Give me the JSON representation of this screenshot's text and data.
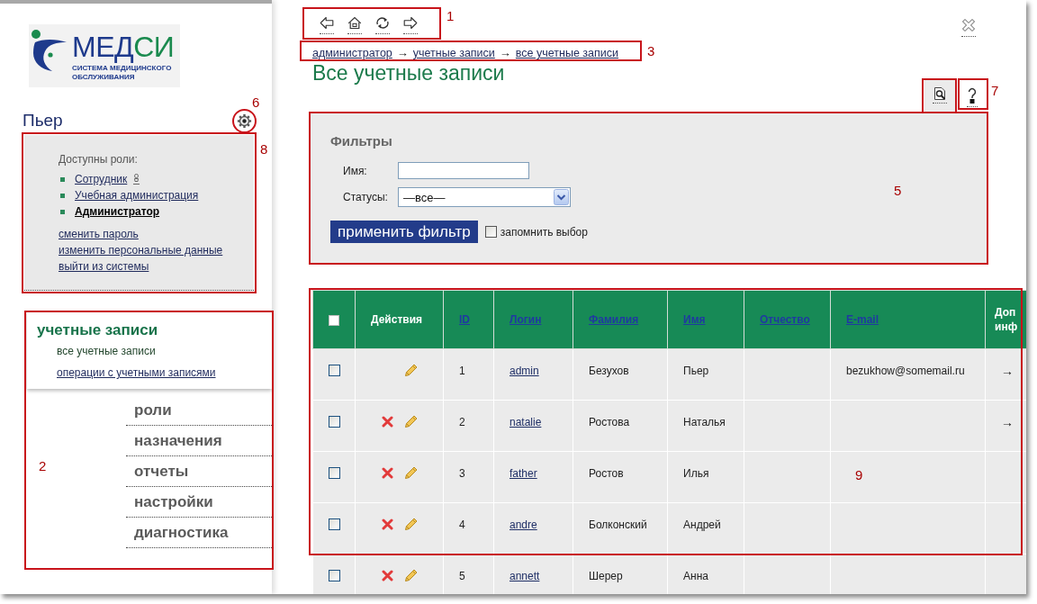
{
  "logo": {
    "wordmark": [
      {
        "text": "МЕД",
        "color": "#1e3a8c"
      },
      {
        "text": "СИ",
        "color": "#1a8a4e"
      }
    ],
    "tagline": "СИСТЕМА МЕДИЦИНСКОГО ОБСЛУЖИВАНИЯ"
  },
  "user": {
    "name": "Пьер",
    "roles_title": "Доступны роли:",
    "roles": [
      {
        "label": "Сотрудник",
        "selected": false,
        "icon": true
      },
      {
        "label": "Учебная администрация",
        "selected": false,
        "icon": false
      },
      {
        "label": "Администратор",
        "selected": true,
        "icon": false
      }
    ],
    "links": [
      "сменить пароль",
      "изменить персональные данные",
      "выйти из системы"
    ]
  },
  "nav": [
    {
      "label": "учетные записи",
      "expanded": true,
      "children": [
        {
          "label": "все учетные записи",
          "selected": true
        },
        {
          "label": "операции с учетными записями",
          "selected": false
        }
      ]
    },
    {
      "label": "роли",
      "expanded": false
    },
    {
      "label": "назначения",
      "expanded": false
    },
    {
      "label": "отчеты",
      "expanded": false
    },
    {
      "label": "настройки",
      "expanded": false
    },
    {
      "label": "диагностика",
      "expanded": false
    }
  ],
  "toolbar": [
    {
      "kind": "back"
    },
    {
      "kind": "home"
    },
    {
      "kind": "refresh"
    },
    {
      "kind": "forward"
    }
  ],
  "breadcrumb": [
    {
      "kind": "link",
      "text": "администратор"
    },
    {
      "kind": "separator",
      "text": "→"
    },
    {
      "kind": "link",
      "text": "учетные записи"
    },
    {
      "kind": "separator",
      "text": "→"
    },
    {
      "kind": "link",
      "text": "все учетные записи"
    }
  ],
  "page_title": "Все учетные записи",
  "tabs": [
    {
      "kind": "search",
      "selected": true
    },
    {
      "kind": "help",
      "selected": false
    }
  ],
  "filters": {
    "title": "Фильтры",
    "fields": [
      {
        "label": "Имя:",
        "kind": "text"
      },
      {
        "label": "Статусы:",
        "kind": "select",
        "value": "—все—"
      }
    ],
    "apply_button": "применить фильтр",
    "remember": {
      "label": "запомнить выбор",
      "checked": false
    }
  },
  "table": {
    "select_all": {
      "checked": false
    },
    "columns": [
      {
        "label": "Действия",
        "sortable": false
      },
      {
        "label": "ID",
        "sortable": true
      },
      {
        "label": "Логин",
        "sortable": true
      },
      {
        "label": "Фамилия",
        "sortable": true
      },
      {
        "label": "Имя",
        "sortable": true
      },
      {
        "label": "Отчество",
        "sortable": true
      },
      {
        "label": "E-mail",
        "sortable": true
      },
      {
        "label": "Доп инф",
        "sortable": false
      }
    ],
    "rows": [
      {
        "checked": false,
        "actions": [
          {
            "kind": "edit"
          }
        ],
        "id": "1",
        "login": "admin",
        "last_name": "Безухов",
        "first_name": "Пьер",
        "email": "bezukhow@somemail.ru",
        "details": "→"
      },
      {
        "checked": false,
        "actions": [
          {
            "kind": "delete"
          },
          {
            "kind": "edit"
          }
        ],
        "id": "2",
        "login": "natalie",
        "last_name": "Ростова",
        "first_name": "Наталья",
        "details": "→"
      },
      {
        "checked": false,
        "actions": [
          {
            "kind": "delete"
          },
          {
            "kind": "edit"
          }
        ],
        "id": "3",
        "login": "father",
        "last_name": "Ростов",
        "first_name": "Илья"
      },
      {
        "checked": false,
        "actions": [
          {
            "kind": "delete"
          },
          {
            "kind": "edit"
          }
        ],
        "id": "4",
        "login": "andre",
        "last_name": "Болконский",
        "first_name": "Андрей"
      },
      {
        "checked": false,
        "actions": [
          {
            "kind": "delete"
          },
          {
            "kind": "edit"
          }
        ],
        "id": "5",
        "login": "annett",
        "last_name": "Шерер",
        "first_name": "Анна"
      }
    ]
  },
  "callouts": [
    {
      "label": "1",
      "kind": "box"
    },
    {
      "label": "2",
      "kind": "box"
    },
    {
      "label": "3",
      "kind": "box"
    },
    {
      "label": "5",
      "kind": "box"
    },
    {
      "label": "6",
      "kind": "circle"
    },
    {
      "label": "7",
      "kind": "box"
    },
    {
      "label": "8",
      "kind": "box"
    },
    {
      "label": "9",
      "kind": "box"
    }
  ]
}
